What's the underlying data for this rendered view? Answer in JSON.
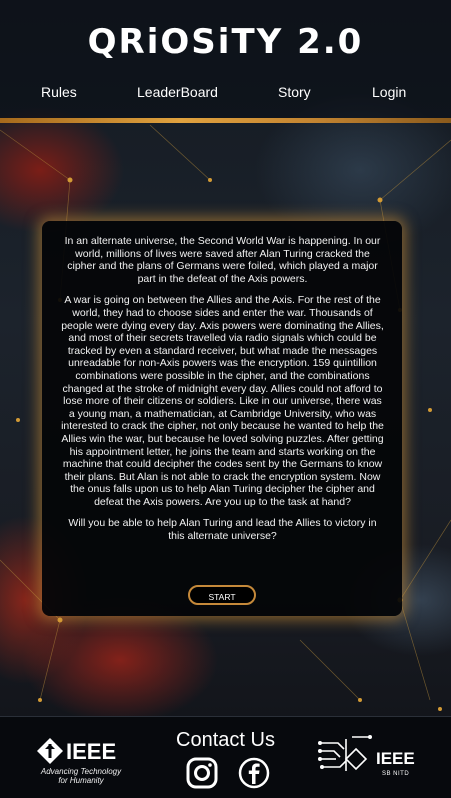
{
  "brand": {
    "title": "QRiOSiTY 2.0"
  },
  "nav": {
    "items": [
      "Rules",
      "LeaderBoard",
      "Story",
      "Login"
    ]
  },
  "story": {
    "paragraphs": [
      "In an alternate universe, the Second World War is happening. In our world, millions of lives were saved after Alan Turing cracked the cipher and the plans of Germans were foiled, which played a major part in the defeat of the Axis powers.",
      "A war is going on between the Allies and the Axis. For the rest of the world, they had to choose sides and enter the war. Thousands of people were dying every day. Axis powers were dominating the Allies, and most of their secrets travelled via radio signals which could be tracked by even a standard receiver, but what made the messages unreadable for non-Axis powers was the encryption. 159 quintillion combinations were possible in the cipher, and the combinations changed at the stroke of midnight every day. Allies could not afford to lose more of their citizens or soldiers. Like in our universe, there was a young man, a mathematician, at Cambridge University, who was interested to crack the cipher, not only because he wanted to help the Allies win the war, but because he loved solving puzzles. After getting his appointment letter, he joins the team and starts working on the machine that could decipher the codes sent by the Germans to know their plans. But Alan is not able to crack the encryption system. Now the onus falls upon us to help Alan Turing decipher the cipher and defeat the Axis powers. Are you up to the task at hand?",
      "Will you be able to help Alan Turing and lead the Allies to victory in this alternate universe?"
    ],
    "start_label": "START"
  },
  "footer": {
    "contact_label": "Contact Us",
    "ieee_left": {
      "word": "IEEE",
      "tagline_1": "Advancing Technology",
      "tagline_2": "for Humanity"
    },
    "ieee_right": {
      "word": "IEEE",
      "sub": "SB NITD"
    }
  },
  "colors": {
    "accent": "#d29a35",
    "card_bg": "#040507",
    "footer_bg": "#07090d"
  }
}
